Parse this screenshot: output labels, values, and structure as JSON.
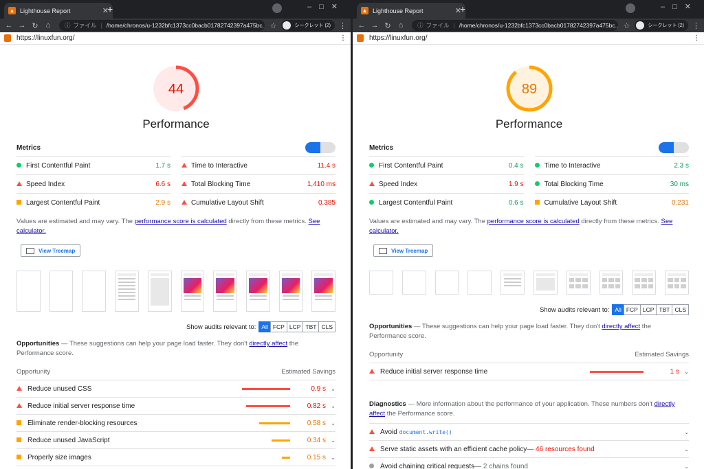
{
  "browser": {
    "tab_title": "Lighthouse Report",
    "address_prefix": "ファイル",
    "address": "/home/chronos/u-1232bfc1373cc0bacb01782742397a475bc...",
    "incognito_label": "シークレット (2)"
  },
  "report_url": "https://linuxfun.org/",
  "left": {
    "score": "44",
    "score_value": 44,
    "score_color": "#ff4e42",
    "category": "Performance",
    "metrics_label": "Metrics",
    "metrics": [
      {
        "name": "First Contentful Paint",
        "value": "1.7 s",
        "status": "pass"
      },
      {
        "name": "Time to Interactive",
        "value": "11.4 s",
        "status": "fail"
      },
      {
        "name": "Speed Index",
        "value": "6.6 s",
        "status": "fail"
      },
      {
        "name": "Total Blocking Time",
        "value": "1,410 ms",
        "status": "fail"
      },
      {
        "name": "Largest Contentful Paint",
        "value": "2.9 s",
        "status": "average"
      },
      {
        "name": "Cumulative Layout Shift",
        "value": "0.385",
        "status": "fail"
      }
    ],
    "note_pre": "Values are estimated and may vary. The ",
    "note_link": "performance score is calculated",
    "note_mid": " directly from these metrics. ",
    "note_link2": "See calculator.",
    "treemap": "View Treemap",
    "audits_label": "Show audits relevant to:",
    "filters": [
      "All",
      "FCP",
      "LCP",
      "TBT",
      "CLS"
    ],
    "opp_title": "Opportunities",
    "opp_pre": " — These suggestions can help your page load faster. They don't ",
    "opp_link": "directly affect",
    "opp_post": " the Performance score.",
    "col_opportunity": "Opportunity",
    "col_savings": "Estimated Savings",
    "opportunities": [
      {
        "name": "Reduce unused CSS",
        "value": "0.9 s",
        "status": "fail",
        "bar_fraction": 0.9
      },
      {
        "name": "Reduce initial server response time",
        "value": "0.82 s",
        "status": "fail",
        "bar_fraction": 0.82
      },
      {
        "name": "Eliminate render-blocking resources",
        "value": "0.58 s",
        "status": "average",
        "bar_fraction": 0.58
      },
      {
        "name": "Reduce unused JavaScript",
        "value": "0.34 s",
        "status": "average",
        "bar_fraction": 0.34
      },
      {
        "name": "Properly size images",
        "value": "0.15 s",
        "status": "average",
        "bar_fraction": 0.15
      }
    ]
  },
  "right": {
    "score": "89",
    "score_value": 89,
    "score_color": "#ffa400",
    "category": "Performance",
    "metrics_label": "Metrics",
    "metrics": [
      {
        "name": "First Contentful Paint",
        "value": "0.4 s",
        "status": "pass"
      },
      {
        "name": "Time to Interactive",
        "value": "2.3 s",
        "status": "pass"
      },
      {
        "name": "Speed Index",
        "value": "1.9 s",
        "status": "fail"
      },
      {
        "name": "Total Blocking Time",
        "value": "30 ms",
        "status": "pass"
      },
      {
        "name": "Largest Contentful Paint",
        "value": "0.6 s",
        "status": "pass"
      },
      {
        "name": "Cumulative Layout Shift",
        "value": "0.231",
        "status": "average"
      }
    ],
    "note_pre": "Values are estimated and may vary. The ",
    "note_link": "performance score is calculated",
    "note_mid": " directly from these metrics. ",
    "note_link2": "See calculator.",
    "treemap": "View Treemap",
    "audits_label": "Show audits relevant to:",
    "filters": [
      "All",
      "FCP",
      "LCP",
      "TBT",
      "CLS"
    ],
    "opp_title": "Opportunities",
    "opp_pre": " — These suggestions can help your page load faster. They don't ",
    "opp_link": "directly affect",
    "opp_post": " the Performance score.",
    "col_opportunity": "Opportunity",
    "col_savings": "Estimated Savings",
    "opportunities": [
      {
        "name": "Reduce initial server response time",
        "value": "1 s",
        "status": "fail",
        "bar_fraction": 1.0
      }
    ],
    "diag_title": "Diagnostics",
    "diag_pre": " — More information about the performance of your application. These numbers don't ",
    "diag_link": "directly affect",
    "diag_post": " the Performance score.",
    "diagnostics": [
      {
        "name": "Avoid ",
        "code": "document.write()",
        "extra": "",
        "status": "fail"
      },
      {
        "name": "Serve static assets with an efficient cache policy",
        "code": "",
        "extra": " — 46 resources found",
        "status": "fail"
      },
      {
        "name": "Avoid chaining critical requests",
        "code": "",
        "extra": " — 2 chains found",
        "status": "info"
      }
    ]
  }
}
